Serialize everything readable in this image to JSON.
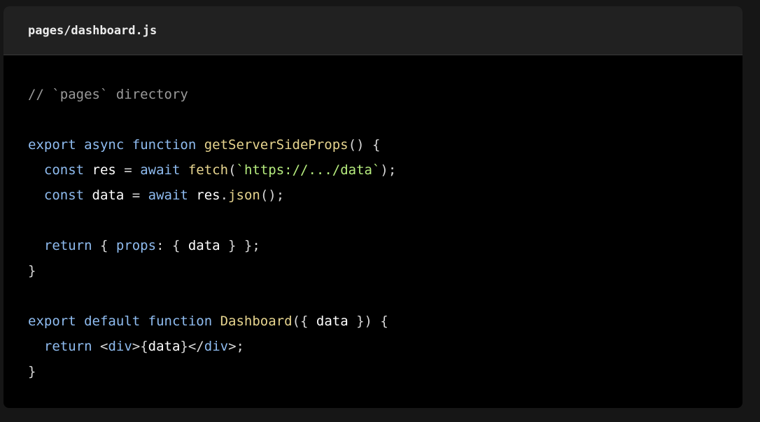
{
  "header": {
    "filename": "pages/dashboard.js"
  },
  "code": {
    "lines": [
      [
        {
          "text": "// `pages` directory",
          "type": "comment"
        }
      ],
      [],
      [
        {
          "text": "export",
          "type": "keyword"
        },
        {
          "text": " ",
          "type": "plain"
        },
        {
          "text": "async",
          "type": "keyword"
        },
        {
          "text": " ",
          "type": "plain"
        },
        {
          "text": "function",
          "type": "keyword"
        },
        {
          "text": " ",
          "type": "plain"
        },
        {
          "text": "getServerSideProps",
          "type": "function"
        },
        {
          "text": "() {",
          "type": "punct"
        }
      ],
      [
        {
          "text": "  ",
          "type": "plain"
        },
        {
          "text": "const",
          "type": "keyword"
        },
        {
          "text": " res ",
          "type": "plain"
        },
        {
          "text": "=",
          "type": "punct"
        },
        {
          "text": " ",
          "type": "plain"
        },
        {
          "text": "await",
          "type": "keyword"
        },
        {
          "text": " ",
          "type": "plain"
        },
        {
          "text": "fetch",
          "type": "function"
        },
        {
          "text": "(",
          "type": "punct"
        },
        {
          "text": "`https://.../data`",
          "type": "string"
        },
        {
          "text": ");",
          "type": "punct"
        }
      ],
      [
        {
          "text": "  ",
          "type": "plain"
        },
        {
          "text": "const",
          "type": "keyword"
        },
        {
          "text": " data ",
          "type": "plain"
        },
        {
          "text": "=",
          "type": "punct"
        },
        {
          "text": " ",
          "type": "plain"
        },
        {
          "text": "await",
          "type": "keyword"
        },
        {
          "text": " res",
          "type": "plain"
        },
        {
          "text": ".",
          "type": "punct"
        },
        {
          "text": "json",
          "type": "function"
        },
        {
          "text": "();",
          "type": "punct"
        }
      ],
      [],
      [
        {
          "text": "  ",
          "type": "plain"
        },
        {
          "text": "return",
          "type": "keyword"
        },
        {
          "text": " { ",
          "type": "punct"
        },
        {
          "text": "props",
          "type": "keyword"
        },
        {
          "text": ": { ",
          "type": "punct"
        },
        {
          "text": "data",
          "type": "plain"
        },
        {
          "text": " } };",
          "type": "punct"
        }
      ],
      [
        {
          "text": "}",
          "type": "punct"
        }
      ],
      [],
      [
        {
          "text": "export",
          "type": "keyword"
        },
        {
          "text": " ",
          "type": "plain"
        },
        {
          "text": "default",
          "type": "keyword"
        },
        {
          "text": " ",
          "type": "plain"
        },
        {
          "text": "function",
          "type": "keyword"
        },
        {
          "text": " ",
          "type": "plain"
        },
        {
          "text": "Dashboard",
          "type": "function"
        },
        {
          "text": "({ ",
          "type": "punct"
        },
        {
          "text": "data",
          "type": "plain"
        },
        {
          "text": " }) {",
          "type": "punct"
        }
      ],
      [
        {
          "text": "  ",
          "type": "plain"
        },
        {
          "text": "return",
          "type": "keyword"
        },
        {
          "text": " ",
          "type": "plain"
        },
        {
          "text": "<",
          "type": "punct"
        },
        {
          "text": "div",
          "type": "keyword"
        },
        {
          "text": ">{",
          "type": "punct"
        },
        {
          "text": "data",
          "type": "plain"
        },
        {
          "text": "}</",
          "type": "punct"
        },
        {
          "text": "div",
          "type": "keyword"
        },
        {
          "text": ">;",
          "type": "punct"
        }
      ],
      [
        {
          "text": "}",
          "type": "punct"
        }
      ]
    ]
  }
}
